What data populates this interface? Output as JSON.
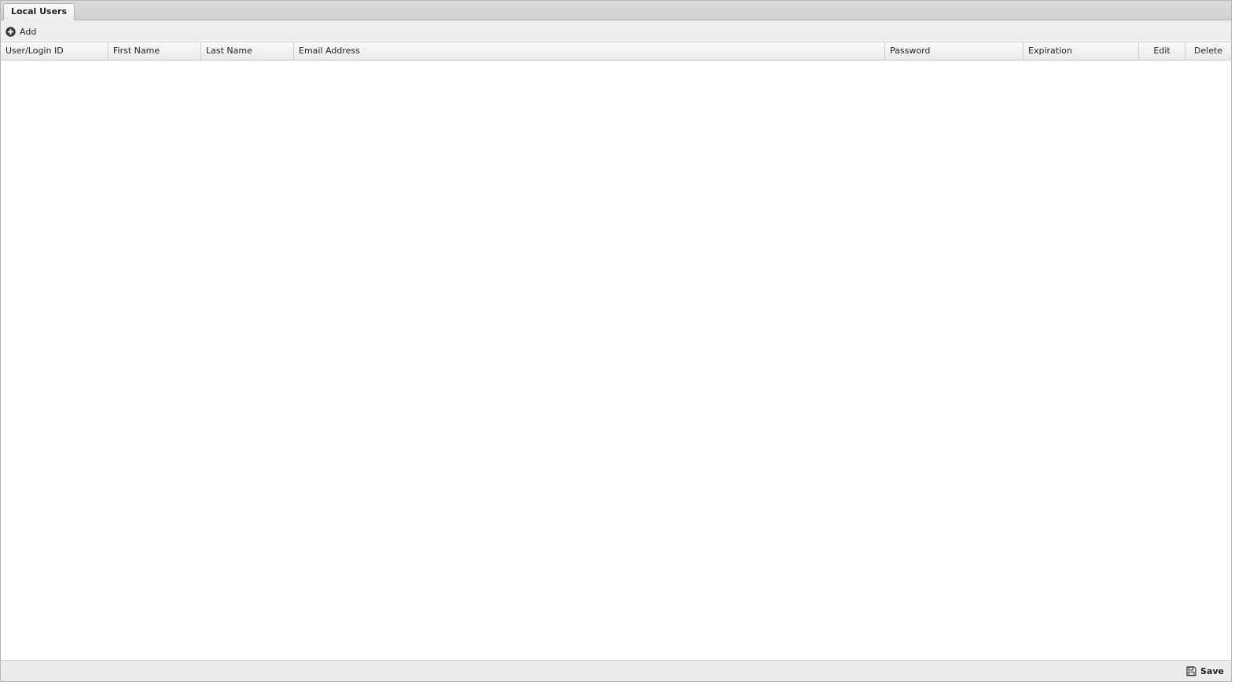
{
  "tabs": [
    {
      "label": "Local Users",
      "active": true
    }
  ],
  "toolbar": {
    "add_label": "Add",
    "add_icon": "plus-circle-icon"
  },
  "grid": {
    "columns": [
      {
        "label": "User/Login ID"
      },
      {
        "label": "First Name"
      },
      {
        "label": "Last Name"
      },
      {
        "label": "Email Address"
      },
      {
        "label": "Password"
      },
      {
        "label": "Expiration"
      },
      {
        "label": "Edit"
      },
      {
        "label": "Delete"
      }
    ],
    "rows": []
  },
  "footer": {
    "save_label": "Save",
    "save_icon": "floppy-disk-icon"
  }
}
